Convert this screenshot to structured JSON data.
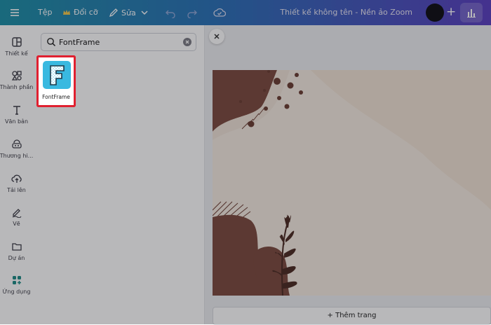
{
  "topbar": {
    "file_label": "Tệp",
    "resize_label": "Đổi cỡ",
    "edit_label": "Sửa",
    "document_title": "Thiết kế không tên - Nền ảo Zoom",
    "plus_label": "+"
  },
  "sidebar": {
    "items": [
      {
        "label": "Thiết kế",
        "icon": "layout-icon"
      },
      {
        "label": "Thành phần",
        "icon": "elements-icon"
      },
      {
        "label": "Văn bản",
        "icon": "text-icon"
      },
      {
        "label": "Thương hi...",
        "icon": "brand-icon"
      },
      {
        "label": "Tải lên",
        "icon": "upload-icon"
      },
      {
        "label": "Vẽ",
        "icon": "draw-icon"
      },
      {
        "label": "Dự án",
        "icon": "folder-icon"
      },
      {
        "label": "Ứng dụng",
        "icon": "apps-icon"
      }
    ]
  },
  "search": {
    "value": "FontFrame"
  },
  "results": [
    {
      "name": "FontFrame",
      "icon_letter": "F"
    }
  ],
  "canvas": {
    "add_page_label": "+ Thêm trang"
  },
  "colors": {
    "highlight": "#e02030",
    "app_icon": "#39b9e0",
    "page_background": "#f5ebe1",
    "shape_dark": "#7b4a3e"
  }
}
